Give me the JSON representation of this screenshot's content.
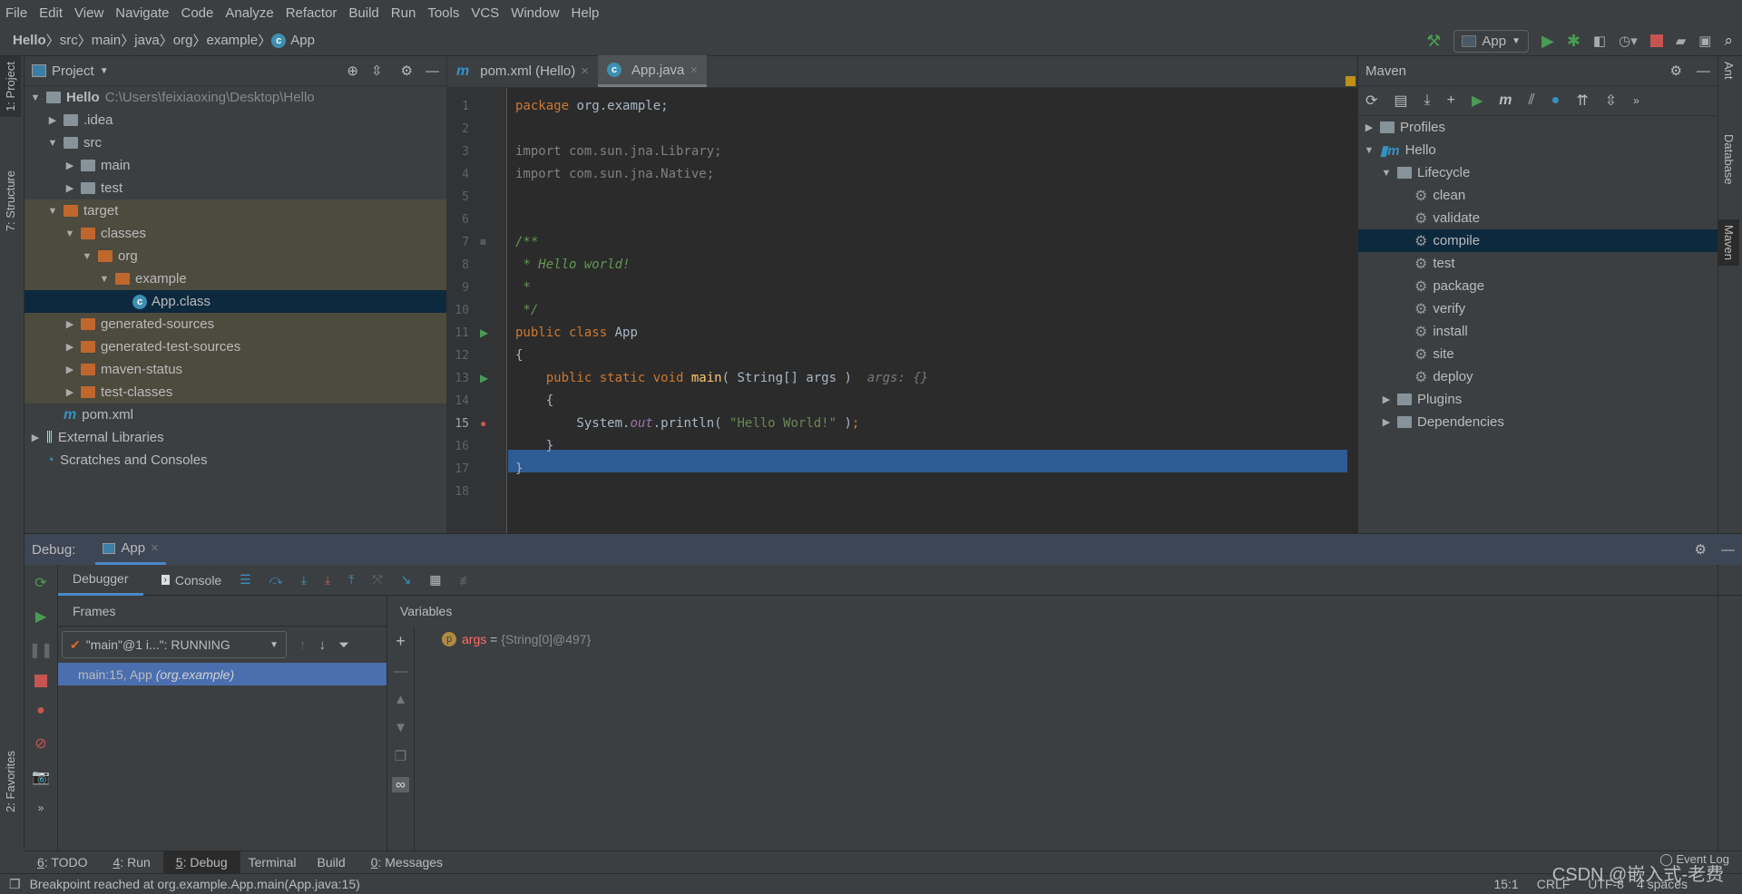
{
  "menu": [
    "File",
    "Edit",
    "View",
    "Navigate",
    "Code",
    "Analyze",
    "Refactor",
    "Build",
    "Run",
    "Tools",
    "VCS",
    "Window",
    "Help"
  ],
  "breadcrumb": [
    "Hello",
    "src",
    "main",
    "java",
    "org",
    "example",
    "App"
  ],
  "run_config": "App",
  "project": {
    "title": "Project",
    "root_name": "Hello",
    "root_path": "C:\\Users\\feixiaoxing\\Desktop\\Hello",
    "items": [
      {
        "label": ".idea",
        "depth": 1,
        "arrow": "▶",
        "icon": "folder"
      },
      {
        "label": "src",
        "depth": 1,
        "arrow": "▼",
        "icon": "folder"
      },
      {
        "label": "main",
        "depth": 2,
        "arrow": "▶",
        "icon": "folder"
      },
      {
        "label": "test",
        "depth": 2,
        "arrow": "▶",
        "icon": "folder"
      },
      {
        "label": "target",
        "depth": 1,
        "arrow": "▼",
        "icon": "folder-orange",
        "excluded": true
      },
      {
        "label": "classes",
        "depth": 2,
        "arrow": "▼",
        "icon": "folder-orange",
        "excluded": true
      },
      {
        "label": "org",
        "depth": 3,
        "arrow": "▼",
        "icon": "folder-orange",
        "excluded": true
      },
      {
        "label": "example",
        "depth": 4,
        "arrow": "▼",
        "icon": "folder-orange",
        "excluded": true
      },
      {
        "label": "App.class",
        "depth": 5,
        "arrow": "",
        "icon": "class",
        "selected": true
      },
      {
        "label": "generated-sources",
        "depth": 2,
        "arrow": "▶",
        "icon": "folder-orange",
        "excluded": true
      },
      {
        "label": "generated-test-sources",
        "depth": 2,
        "arrow": "▶",
        "icon": "folder-orange",
        "excluded": true
      },
      {
        "label": "maven-status",
        "depth": 2,
        "arrow": "▶",
        "icon": "folder-orange",
        "excluded": true
      },
      {
        "label": "test-classes",
        "depth": 2,
        "arrow": "▶",
        "icon": "folder-orange",
        "excluded": true
      },
      {
        "label": "pom.xml",
        "depth": 1,
        "arrow": "",
        "icon": "maven"
      },
      {
        "label": "External Libraries",
        "depth": 0,
        "arrow": "▶",
        "icon": "libraries"
      },
      {
        "label": "Scratches and Consoles",
        "depth": 0,
        "arrow": "",
        "icon": "scratches"
      }
    ]
  },
  "editor": {
    "tabs": [
      {
        "label": "pom.xml (Hello)",
        "icon": "maven",
        "active": false
      },
      {
        "label": "App.java",
        "icon": "class",
        "active": true
      }
    ],
    "current_line": 15,
    "lines": [
      "<span class='kw'>package</span> org.example;",
      "",
      "<span class='gr'>import com.sun.jna.Library;</span>",
      "<span class='gr'>import com.sun.jna.Native;</span>",
      "",
      "",
      "<span class='cm'>/**</span>",
      "<span class='cm'> * Hello world!</span>",
      "<span class='cm'> *</span>",
      "<span class='cm'> */</span>",
      "<span class='kw'>public class</span> App",
      "{",
      "    <span class='kw'>public static void</span> <span class='fn'>main</span>( String[] args )  <span class='hint'>args: {}</span>",
      "    {",
      "        System.<span class='fld'>out</span>.println( <span class='st'>\"Hello World!\"</span> <span>)</span><span class='kw'>;</span>",
      "    }",
      "}",
      ""
    ]
  },
  "maven": {
    "title": "Maven",
    "items": [
      {
        "label": "Profiles",
        "depth": 0,
        "arrow": "▶",
        "icon": "profiles"
      },
      {
        "label": "Hello",
        "depth": 0,
        "arrow": "▼",
        "icon": "maven-project"
      },
      {
        "label": "Lifecycle",
        "depth": 1,
        "arrow": "▼",
        "icon": "folder-gear"
      },
      {
        "label": "clean",
        "depth": 2,
        "icon": "gear"
      },
      {
        "label": "validate",
        "depth": 2,
        "icon": "gear"
      },
      {
        "label": "compile",
        "depth": 2,
        "icon": "gear",
        "selected": true
      },
      {
        "label": "test",
        "depth": 2,
        "icon": "gear"
      },
      {
        "label": "package",
        "depth": 2,
        "icon": "gear"
      },
      {
        "label": "verify",
        "depth": 2,
        "icon": "gear"
      },
      {
        "label": "install",
        "depth": 2,
        "icon": "gear"
      },
      {
        "label": "site",
        "depth": 2,
        "icon": "gear"
      },
      {
        "label": "deploy",
        "depth": 2,
        "icon": "gear"
      },
      {
        "label": "Plugins",
        "depth": 1,
        "arrow": "▶",
        "icon": "folder-gear"
      },
      {
        "label": "Dependencies",
        "depth": 1,
        "arrow": "▶",
        "icon": "dependencies"
      }
    ]
  },
  "left_stripe": {
    "project": "1: Project",
    "structure": "7: Structure",
    "favorites": "2: Favorites"
  },
  "right_stripe": {
    "ant": "Ant",
    "database": "Database",
    "maven": "Maven"
  },
  "debug": {
    "label": "Debug:",
    "session": "App",
    "tabs": {
      "debugger": "Debugger",
      "console": "Console"
    },
    "frames_title": "Frames",
    "thread": "\"main\"@1 i...\": RUNNING",
    "frame_main": "main:15, App",
    "frame_pkg": "(org.example)",
    "variables_title": "Variables",
    "var_name": "args",
    "var_eq": " = ",
    "var_value": "{String[0]@497}"
  },
  "bottom_tabs": [
    {
      "key": "6",
      "label": ": TODO"
    },
    {
      "key": "4",
      "label": ": Run"
    },
    {
      "key": "5",
      "label": ": Debug",
      "active": true
    },
    {
      "key": "",
      "label": "Terminal"
    },
    {
      "key": "",
      "label": "Build"
    },
    {
      "key": "0",
      "label": ": Messages"
    }
  ],
  "event_log": "Event Log",
  "status": {
    "message": "Breakpoint reached at org.example.App.main(App.java:15)",
    "position": "15:1",
    "line_sep": "CRLF",
    "encoding": "UTF-8",
    "indent": "4 spaces"
  },
  "watermark": "CSDN @嵌入式-老费",
  "colors": {
    "accent": "#4a88c7",
    "selection": "#2d5b94",
    "tree_selection": "#0d293e",
    "excluded": "#4d4a3e"
  }
}
